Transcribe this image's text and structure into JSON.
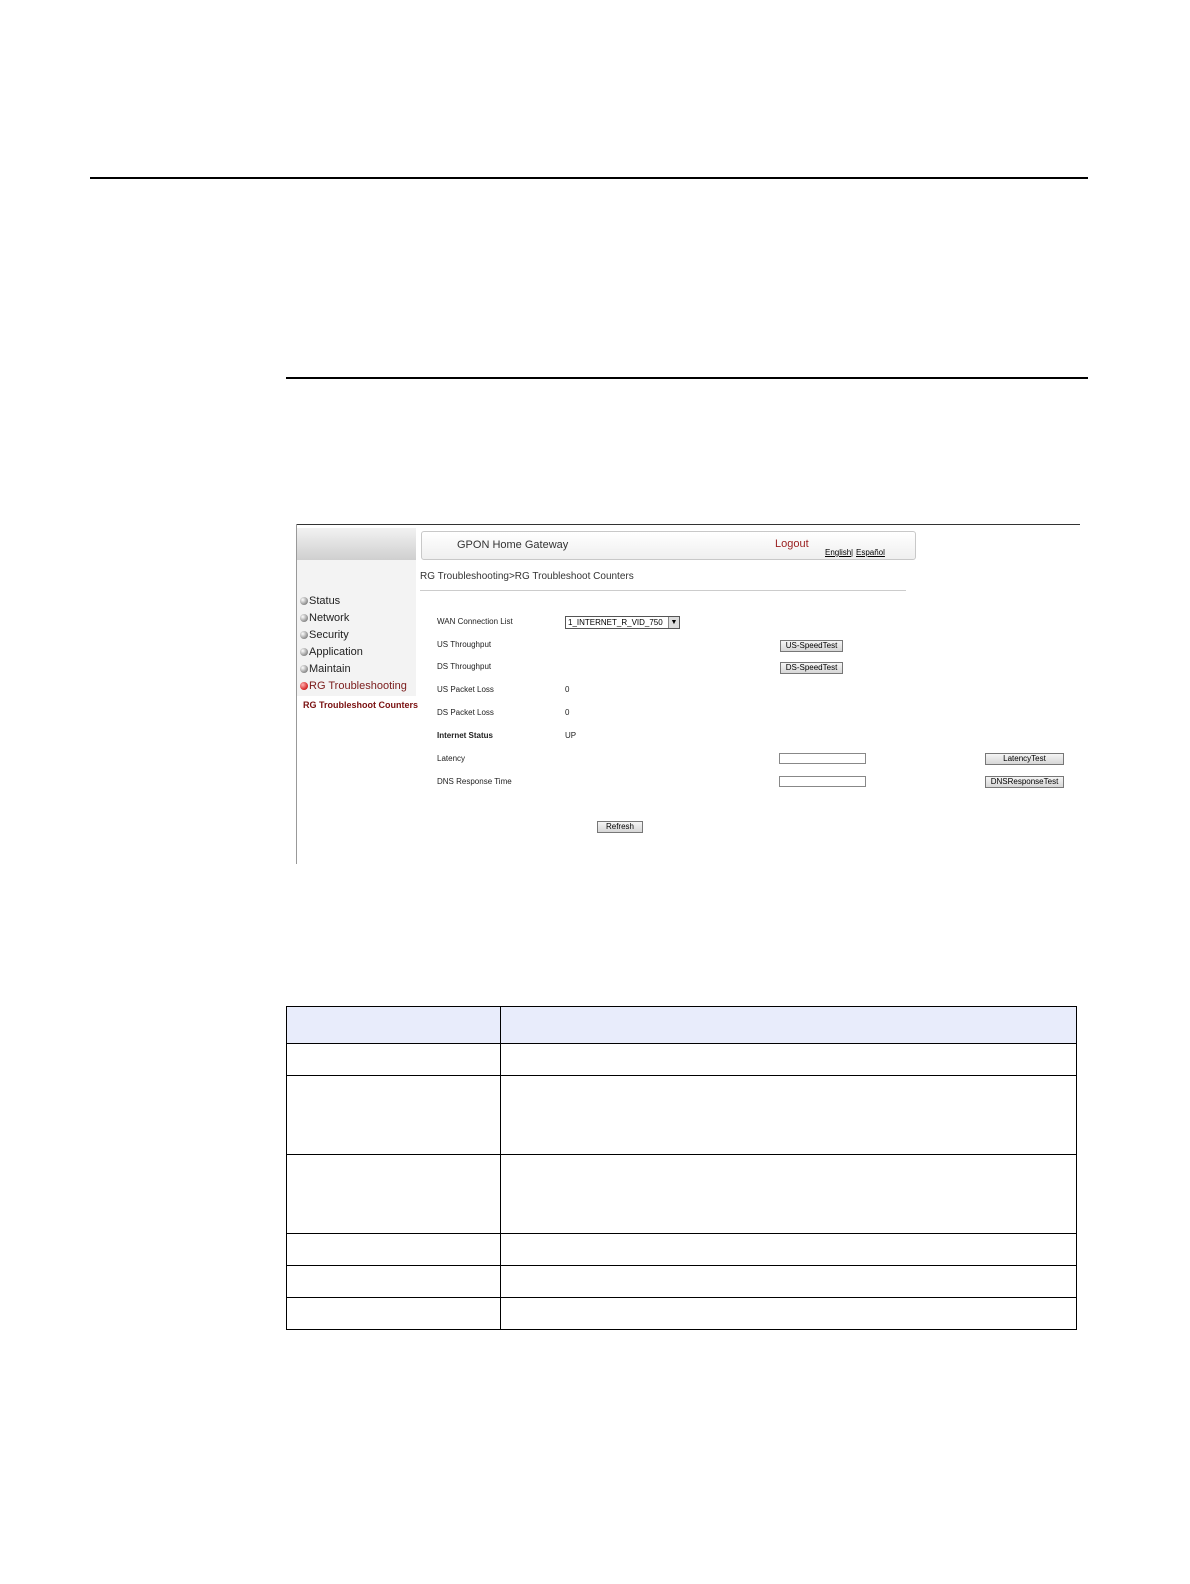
{
  "app": {
    "header_title": "GPON Home Gateway",
    "logout": "Logout",
    "lang_english": "English",
    "lang_separator": "|",
    "lang_espanol": "Español"
  },
  "sidebar": {
    "items": [
      {
        "label": "Status"
      },
      {
        "label": "Network"
      },
      {
        "label": "Security"
      },
      {
        "label": "Application"
      },
      {
        "label": "Maintain"
      },
      {
        "label": "RG Troubleshooting"
      }
    ],
    "sub_item": "RG Troubleshoot Counters"
  },
  "breadcrumb": "RG Troubleshooting>RG Troubleshoot Counters",
  "form": {
    "wan_label": "WAN Connection List",
    "wan_value": "1_INTERNET_R_VID_750",
    "us_throughput_label": "US Throughput",
    "ds_throughput_label": "DS Throughput",
    "us_packet_loss_label": "US Packet Loss",
    "us_packet_loss_value": "0",
    "ds_packet_loss_label": "DS Packet Loss",
    "ds_packet_loss_value": "0",
    "internet_status_label": "Internet Status",
    "internet_status_value": "UP",
    "latency_label": "Latency",
    "dns_label": "DNS Response Time",
    "us_speedtest_button": "US-SpeedTest",
    "ds_speedtest_button": "DS-SpeedTest",
    "latency_button": "LatencyTest",
    "dns_button": "DNSResponseTest",
    "refresh_button": "Refresh"
  },
  "table": {
    "headers": [
      "",
      ""
    ],
    "rows": [
      [
        "",
        ""
      ],
      [
        "",
        ""
      ],
      [
        "",
        ""
      ],
      [
        "",
        ""
      ],
      [
        "",
        ""
      ],
      [
        "",
        ""
      ]
    ]
  }
}
